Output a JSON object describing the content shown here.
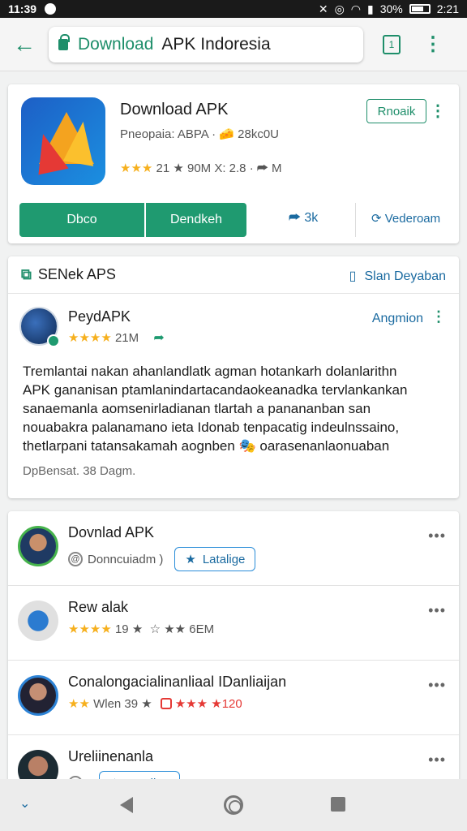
{
  "status_bar": {
    "time": "11:39",
    "battery": "30%",
    "clock_right": "2:21"
  },
  "browser": {
    "url_green": "Download",
    "url_dark": "APK Indoresia"
  },
  "app": {
    "title": "Download APK",
    "meta": "Pneopaia: ABPA · 🧀 28kc0U",
    "stars": "★★★",
    "rating_text": "21 ★ 90M X: 2.8 · ⮫ M",
    "pill": "Rnoaik",
    "btn_primary": "Dbco",
    "btn_secondary": "Dendkeh",
    "share_label": "3k",
    "video_label": "Vederoam"
  },
  "review_section": {
    "title": "SENek APS",
    "link": "Slan Deyaban",
    "reviewer": "PeydAPK",
    "stars": "★★★★",
    "rating_text": "21M",
    "action": "Angmion",
    "body": [
      "Tremlantai nakan ahanlandlatk agman hotankarh dolanlarithn",
      "APK gananisan ptamlanindartacandaokeanadka tervlankankan",
      "sanaemanla aomsenirladianan tlartah a panananban san",
      "nouabakra palanamano ieta Idonab tenpacatig indeulnssaino,",
      "thetlarpani tatansakamah aognben 🎭 oarasenanlaonuaban"
    ],
    "date": "DpBensat. 38 Dagm."
  },
  "list": [
    {
      "title": "Dovnlad APK",
      "sub": "Donncuiadm )",
      "chip": "Latalige"
    },
    {
      "title": "Rew alak",
      "stars": "★★★★",
      "rating_text": "19 ★",
      "extra": "☆ ★★ 6EM"
    },
    {
      "title": "Conalongacialinanliaal IDanliaijan",
      "stars": "★★",
      "rating_text": "Wlen 39 ★",
      "extra": "★★★ ★120"
    },
    {
      "title": "Ureliinenanla",
      "sub": "",
      "chip": "Latalige"
    }
  ]
}
